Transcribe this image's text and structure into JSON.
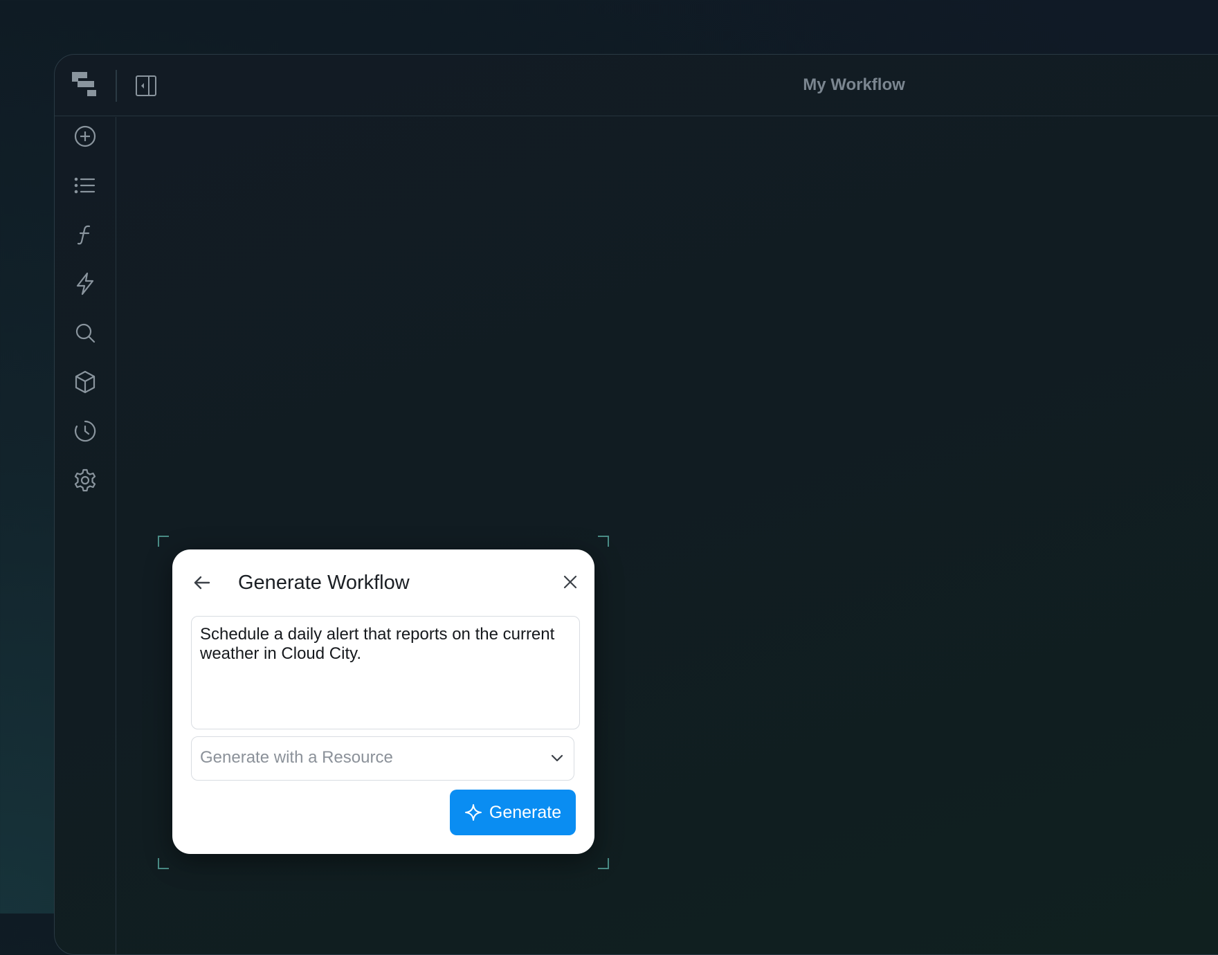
{
  "window": {
    "title": "My Workflow"
  },
  "topbar": {
    "logo": "logo-icon",
    "panel_toggle": "sidebar-toggle-icon"
  },
  "sidebar": {
    "items": [
      {
        "name": "add",
        "icon": "plus-circle-icon"
      },
      {
        "name": "list",
        "icon": "list-icon"
      },
      {
        "name": "functions",
        "icon": "function-icon"
      },
      {
        "name": "triggers",
        "icon": "lightning-icon"
      },
      {
        "name": "search",
        "icon": "search-icon"
      },
      {
        "name": "packages",
        "icon": "cube-icon"
      },
      {
        "name": "history",
        "icon": "history-icon"
      },
      {
        "name": "settings",
        "icon": "gear-icon"
      }
    ]
  },
  "dialog": {
    "title": "Generate Workflow",
    "prompt": "Schedule a daily alert that reports on the current weather in Cloud City.",
    "resource_placeholder": "Generate with a Resource",
    "generate_label": "Generate"
  },
  "colors": {
    "accent": "#0a8df2",
    "background": "#0f1b24",
    "sidebar_icon": "#8a959e",
    "corner_marker": "#4a8c86"
  }
}
